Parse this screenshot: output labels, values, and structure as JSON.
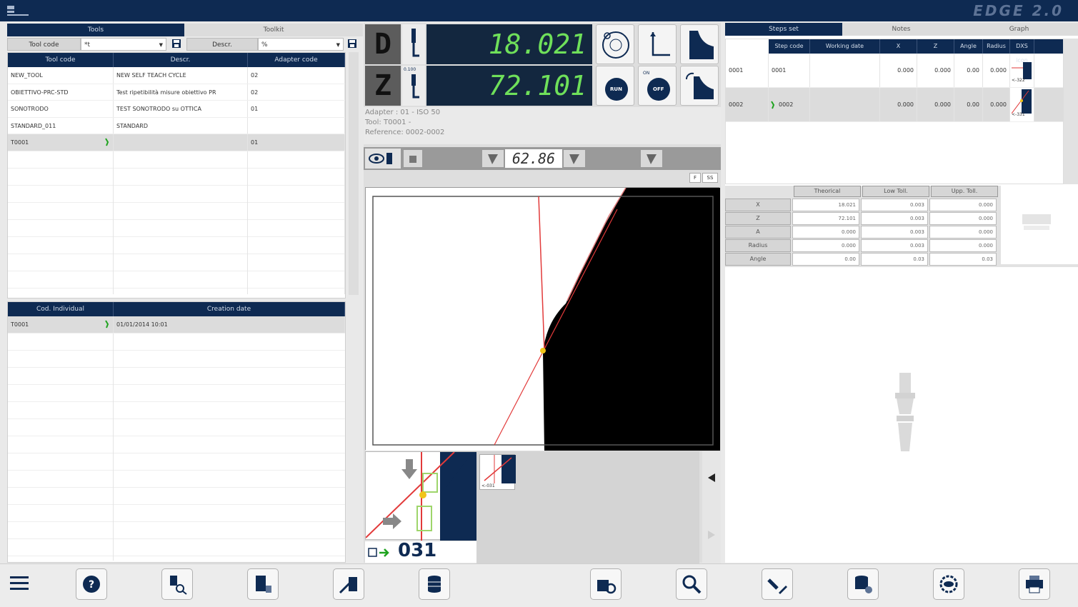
{
  "app": {
    "brand": "EDGE 2.0"
  },
  "left": {
    "tabs": [
      "Tools",
      "Toolkit"
    ],
    "filter": {
      "code_label": "Tool code",
      "code_value": "*t",
      "descr_label": "Descr.",
      "descr_value": "%"
    },
    "tools_table": {
      "columns": [
        "Tool code",
        "Descr.",
        "Adapter code"
      ],
      "rows": [
        {
          "code": "NEW_TOOL",
          "descr": "NEW SELF TEACH CYCLE",
          "adapter": "02"
        },
        {
          "code": "OBIETTIVO-PRC-STD",
          "descr": "Test ripetibilità misure obiettivo PR",
          "adapter": "02"
        },
        {
          "code": "SONOTRODO",
          "descr": "TEST SONOTRODO su OTTICA",
          "adapter": "01"
        },
        {
          "code": "STANDARD_011",
          "descr": "STANDARD",
          "adapter": ""
        },
        {
          "code": "T0001",
          "descr": "",
          "adapter": "01"
        }
      ]
    },
    "indiv_table": {
      "columns": [
        "Cod. Individual",
        "Creation date"
      ],
      "rows": [
        {
          "code": "T0001",
          "date": "01/01/2014 10:01"
        }
      ]
    }
  },
  "center": {
    "dro": [
      {
        "axis": "D",
        "value": "18.021"
      },
      {
        "axis": "Z",
        "value": "72.101"
      }
    ],
    "small_label": "0.100",
    "info": {
      "adapter": "Adapter : 01 - ISO 50",
      "tool": "Tool: T0001 -",
      "reference": "Reference: 0002-0002"
    },
    "angle_value": "62.86",
    "mini_buttons": [
      "F",
      "SS"
    ],
    "run_label": "RUN",
    "off_label": "OFF",
    "on_label": "ON",
    "step_display": "031",
    "thumb_label": "<-031"
  },
  "right": {
    "tabs": [
      "Steps set",
      "Notes",
      "Graph"
    ],
    "steps_table": {
      "columns": [
        "Step code",
        "Working date",
        "X",
        "Z",
        "Angle",
        "Radius",
        "DXS icon"
      ],
      "rows": [
        {
          "id": "0001",
          "code": "0001",
          "x": "0.000",
          "z": "0.000",
          "angle": "0.00",
          "radius": "0.000",
          "icon_label": "<-322"
        },
        {
          "id": "0002",
          "code": "0002",
          "x": "0.000",
          "z": "0.000",
          "angle": "0.00",
          "radius": "0.000",
          "icon_label": "<-331"
        }
      ]
    },
    "tolerance": {
      "columns": [
        "Theorical",
        "Low Toll.",
        "Upp. Toll."
      ],
      "rows": [
        {
          "label": "X",
          "theorical": "18.021",
          "low": "0.003",
          "upp": "0.000"
        },
        {
          "label": "Z",
          "theorical": "72.101",
          "low": "0.003",
          "upp": "0.000"
        },
        {
          "label": "A",
          "theorical": "0.000",
          "low": "0.003",
          "upp": "0.000"
        },
        {
          "label": "Radius",
          "theorical": "0.000",
          "low": "0.003",
          "upp": "0.000"
        },
        {
          "label": "Angle",
          "theorical": "0.00",
          "low": "0.03",
          "upp": "0.03"
        }
      ]
    }
  },
  "bottom_toolbar": {
    "icons": [
      "menu-icon",
      "help-icon",
      "tool-search-icon",
      "tool-list-icon",
      "tool-measure-icon",
      "database-icon",
      "tool-settings-icon",
      "zoom-icon",
      "edit-tool-icon",
      "database-export-icon",
      "eye-settings-icon",
      "print-icon"
    ]
  },
  "colors": {
    "navy": "#0e2a52",
    "dro_green": "#6fe05a",
    "accent_yellow": "#f0c419",
    "red_line": "#e23a3a"
  }
}
